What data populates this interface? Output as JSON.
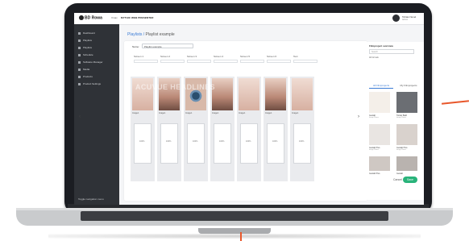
{
  "app": {
    "logo": "BD Rowa",
    "tag": "Vmax",
    "name": "MYTHIC WEB PRESENTER",
    "user_name": "Tobias Nevel",
    "user_role": "Admin"
  },
  "sidebar": {
    "items": [
      {
        "label": "Dashboard",
        "icon": "dashboard-icon"
      },
      {
        "label": "Playlists",
        "icon": "playlist-icon"
      },
      {
        "label": "Playlists",
        "icon": "playlist-icon"
      },
      {
        "label": "Schedule",
        "icon": "calendar-icon"
      },
      {
        "label": "Software Manager",
        "icon": "software-icon"
      },
      {
        "label": "Media",
        "icon": "media-icon"
      },
      {
        "label": "Products",
        "icon": "products-icon"
      },
      {
        "label": "Product Settings",
        "icon": "settings-icon"
      }
    ],
    "footer": "Toggle navigation menu"
  },
  "breadcrumb": {
    "root": "Playlists",
    "sep": "/",
    "current": "Playlist example"
  },
  "editor": {
    "name_label": "Name:",
    "name_value": "Playlist example",
    "columns": [
      {
        "label": "Screen 1",
        "thumb": "pale",
        "cap": "Image1"
      },
      {
        "label": "Screen 2",
        "thumb": "lash",
        "cap": "Image1"
      },
      {
        "label": "Screen 3",
        "thumb": "eye",
        "cap": "Image1"
      },
      {
        "label": "Screen 4",
        "thumb": "lash",
        "cap": "Image1"
      },
      {
        "label": "Screen 5",
        "thumb": "pale",
        "cap": "Image1"
      },
      {
        "label": "Screen 6",
        "thumb": "lash",
        "cap": "Image1"
      },
      {
        "label": "Text",
        "thumb": "pale",
        "cap": "Image1"
      }
    ],
    "overlay_text": "ACUVUE HEADLINES",
    "phone_label": "100%",
    "left_arrow": "‹",
    "right_arrow": "›"
  },
  "panel": {
    "title": "Filmproject overview",
    "search_placeholder": "Search",
    "filter": "All formats",
    "tabs": [
      "All Filmprojects",
      "My Filmprojects"
    ],
    "items": [
      {
        "caption": "Gestalt",
        "sub": "Image Phone"
      },
      {
        "caption": "Tonkel Bald",
        "sub": "Image Phone"
      },
      {
        "caption": "Gestalt Plus",
        "sub": "Image Phone"
      },
      {
        "caption": "Gestalt Plus",
        "sub": "Image Phone"
      },
      {
        "caption": "Gestalt Plus",
        "sub": "Image Phone"
      },
      {
        "caption": "Gestalt",
        "sub": "Image Phone"
      }
    ]
  },
  "actions": {
    "cancel": "Cancel",
    "save": "Save"
  }
}
